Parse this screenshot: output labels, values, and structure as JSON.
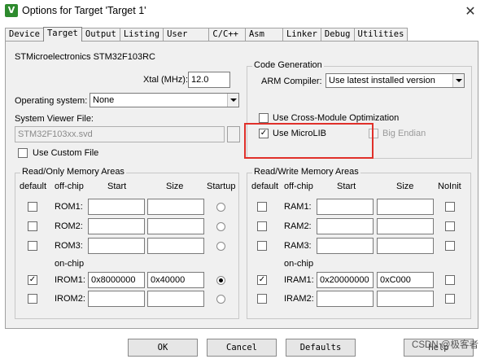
{
  "window": {
    "title": "Options for Target 'Target 1'",
    "close": "✕"
  },
  "tabs": [
    "Device",
    "Target",
    "Output",
    "Listing",
    "User",
    "C/C++",
    "Asm",
    "Linker",
    "Debug",
    "Utilities"
  ],
  "device": {
    "name": "STMicroelectronics STM32F103RC",
    "xtal_label": "Xtal (MHz):",
    "xtal_value": "12.0",
    "os_label": "Operating system:",
    "os_value": "None",
    "svd_label": "System Viewer File:",
    "svd_value": "STM32F103xx.svd",
    "custom_file_label": "Use Custom File"
  },
  "codegen": {
    "title": "Code Generation",
    "compiler_label": "ARM Compiler:",
    "compiler_value": "Use latest installed version",
    "cross_module_label": "Use Cross-Module Optimization",
    "microlib_label": "Use MicroLIB",
    "big_endian_label": "Big Endian"
  },
  "rom_area": {
    "title": "Read/Only Memory Areas",
    "headers": {
      "default": "default",
      "offchip": "off-chip",
      "start": "Start",
      "size": "Size",
      "startup": "Startup"
    },
    "onchip_label": "on-chip",
    "rows": [
      {
        "label": "ROM1:",
        "start": "",
        "size": ""
      },
      {
        "label": "ROM2:",
        "start": "",
        "size": ""
      },
      {
        "label": "ROM3:",
        "start": "",
        "size": ""
      },
      {
        "label": "IROM1:",
        "start": "0x8000000",
        "size": "0x40000"
      },
      {
        "label": "IROM2:",
        "start": "",
        "size": ""
      }
    ]
  },
  "ram_area": {
    "title": "Read/Write Memory Areas",
    "headers": {
      "default": "default",
      "offchip": "off-chip",
      "start": "Start",
      "size": "Size",
      "noinit": "NoInit"
    },
    "onchip_label": "on-chip",
    "rows": [
      {
        "label": "RAM1:",
        "start": "",
        "size": ""
      },
      {
        "label": "RAM2:",
        "start": "",
        "size": ""
      },
      {
        "label": "RAM3:",
        "start": "",
        "size": ""
      },
      {
        "label": "IRAM1:",
        "start": "0x20000000",
        "size": "0xC000"
      },
      {
        "label": "IRAM2:",
        "start": "",
        "size": ""
      }
    ]
  },
  "buttons": {
    "ok": "OK",
    "cancel": "Cancel",
    "defaults": "Defaults",
    "help": "Help"
  },
  "watermark": "CSDN @极客者",
  "checkmark": "✓",
  "colors": {
    "highlight": "#e0302a",
    "app_icon": "#2e8b2e"
  }
}
